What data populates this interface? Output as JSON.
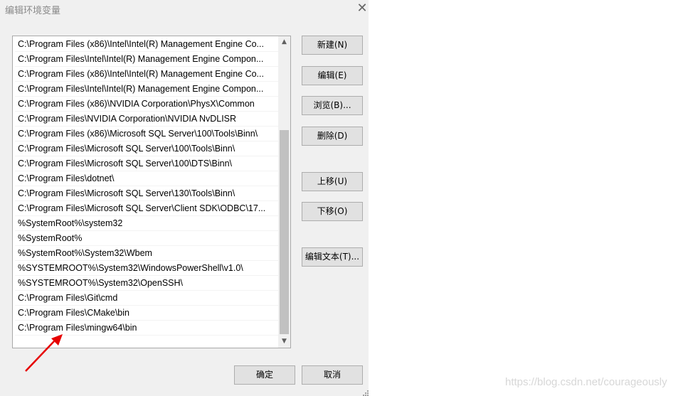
{
  "dialog": {
    "title": "编辑环境变量",
    "close_icon": "close-icon"
  },
  "path_list": {
    "items": [
      "C:\\Program Files (x86)\\Intel\\Intel(R) Management Engine Co...",
      "C:\\Program Files\\Intel\\Intel(R) Management Engine Compon...",
      "C:\\Program Files (x86)\\Intel\\Intel(R) Management Engine Co...",
      "C:\\Program Files\\Intel\\Intel(R) Management Engine Compon...",
      "C:\\Program Files (x86)\\NVIDIA Corporation\\PhysX\\Common",
      "C:\\Program Files\\NVIDIA Corporation\\NVIDIA NvDLISR",
      "C:\\Program Files (x86)\\Microsoft SQL Server\\100\\Tools\\Binn\\",
      "C:\\Program Files\\Microsoft SQL Server\\100\\Tools\\Binn\\",
      "C:\\Program Files\\Microsoft SQL Server\\100\\DTS\\Binn\\",
      "C:\\Program Files\\dotnet\\",
      "C:\\Program Files\\Microsoft SQL Server\\130\\Tools\\Binn\\",
      "C:\\Program Files\\Microsoft SQL Server\\Client SDK\\ODBC\\17...",
      "%SystemRoot%\\system32",
      "%SystemRoot%",
      "%SystemRoot%\\System32\\Wbem",
      "%SYSTEMROOT%\\System32\\WindowsPowerShell\\v1.0\\",
      "%SYSTEMROOT%\\System32\\OpenSSH\\",
      "C:\\Program Files\\Git\\cmd",
      "C:\\Program Files\\CMake\\bin",
      "C:\\Program Files\\mingw64\\bin"
    ]
  },
  "buttons": {
    "new": "新建(N)",
    "edit": "编辑(E)",
    "browse": "浏览(B)...",
    "delete": "删除(D)",
    "move_up": "上移(U)",
    "move_down": "下移(O)",
    "edit_text": "编辑文本(T)...",
    "ok": "确定",
    "cancel": "取消"
  },
  "annotation": {
    "arrow_color": "#ff0000"
  },
  "watermark": "https://blog.csdn.net/courageously"
}
